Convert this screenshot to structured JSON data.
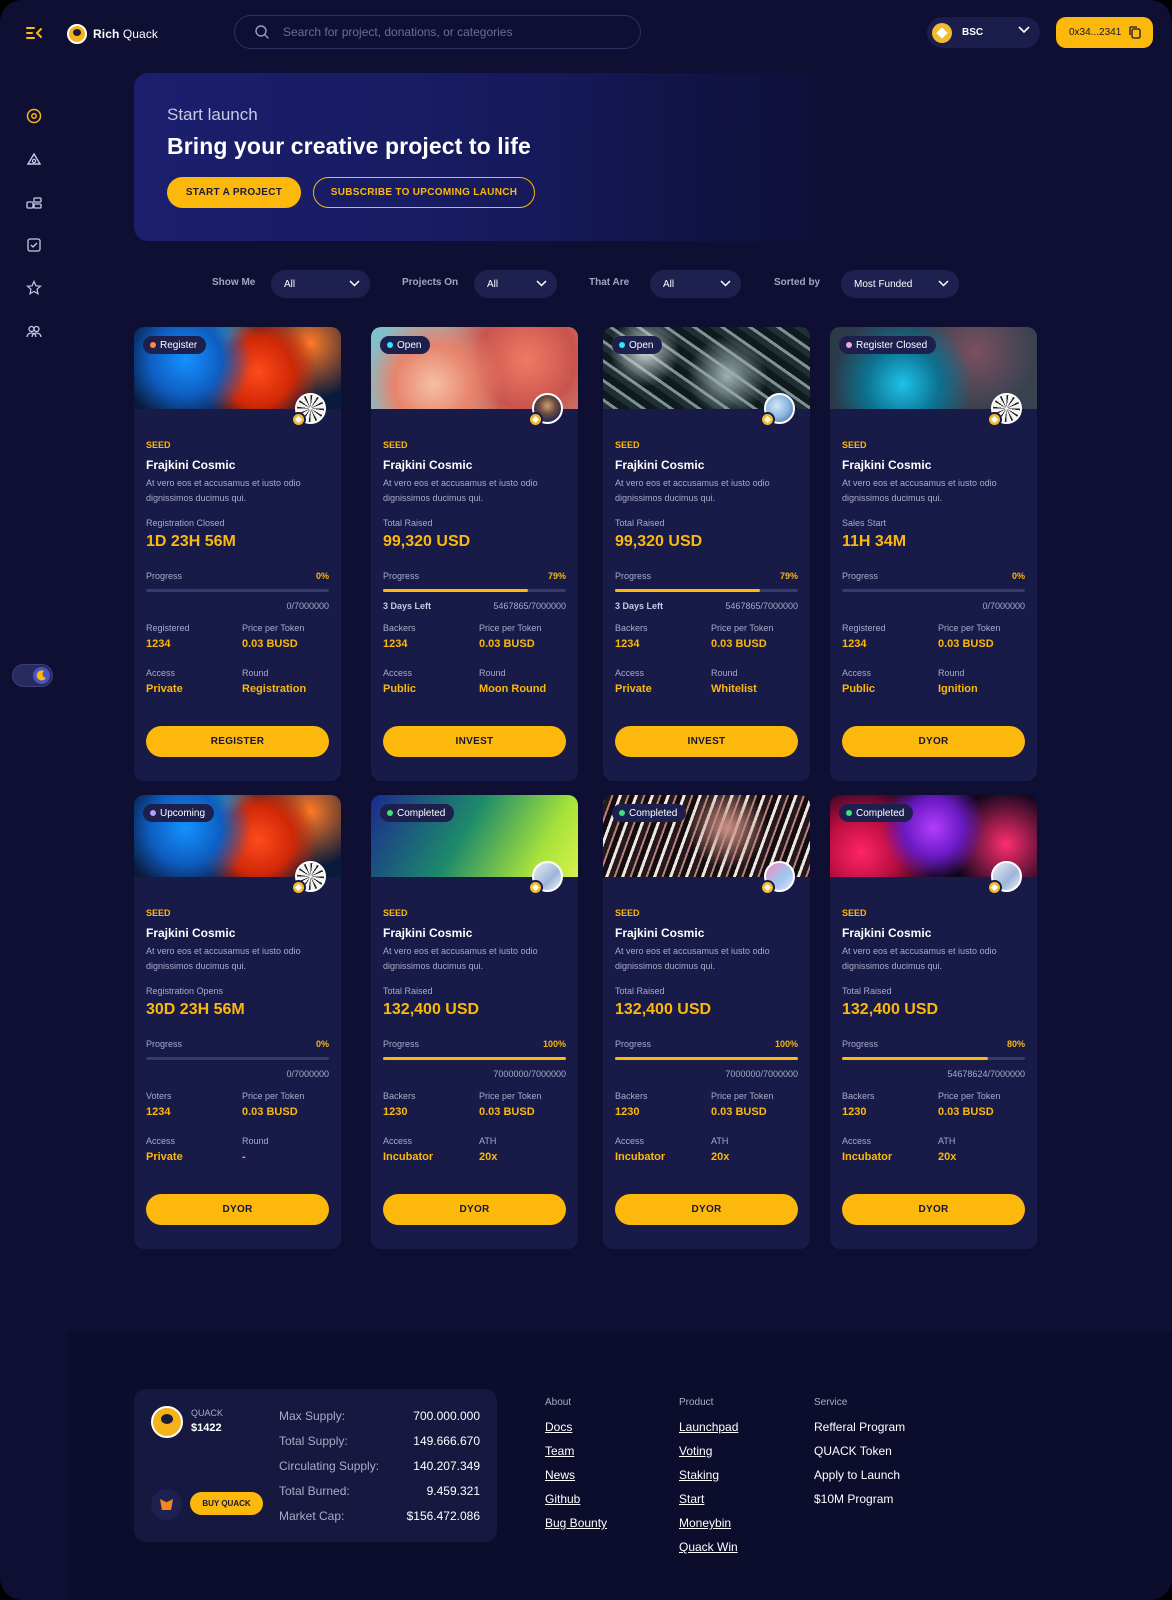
{
  "header": {
    "logo_bold": "Rich",
    "logo_light": "Quack",
    "search_placeholder": "Search for project, donations, or categories",
    "chain": "BSC",
    "wallet": "0x34...2341"
  },
  "hero": {
    "kicker": "Start launch",
    "title": "Bring your creative project to life",
    "start_btn": "START A PROJECT",
    "subscribe_btn": "SUBSCRIBE TO UPCOMING LAUNCH"
  },
  "filters": {
    "show_me": {
      "label": "Show Me",
      "value": "All"
    },
    "projects_on": {
      "label": "Projects On",
      "value": "All"
    },
    "that_are": {
      "label": "That Are",
      "value": "All"
    },
    "sorted_by": {
      "label": "Sorted by",
      "value": "Most Funded"
    }
  },
  "colors": {
    "accent": "#fcb80b",
    "background": "#0e0f33",
    "card": "#181a48"
  },
  "cards": [
    {
      "status": "Register",
      "dot": "#ff8a3d",
      "image": "fire",
      "avatar": "a",
      "stage": "SEED",
      "title": "Frajkini Cosmic",
      "desc": "At vero eos et accusamus et iusto odio dignissimos ducimus qui.",
      "stat_label": "Registration Closed",
      "stat_value": "1D 23H 56M",
      "progress_label": "Progress",
      "progress_pct": "0%",
      "progress": 0,
      "days_left": "",
      "count": "0/7000000",
      "k1": "Registered",
      "v1": "1234",
      "k2": "Price per Token",
      "v2": "0.03 BUSD",
      "k3": "Access",
      "v3": "Private",
      "k4": "Round",
      "v4": "Registration",
      "button": "REGISTER"
    },
    {
      "status": "Open",
      "dot": "#2ee6ff",
      "image": "cloud",
      "avatar": "b",
      "stage": "SEED",
      "title": "Frajkini Cosmic",
      "desc": "At vero eos et accusamus et iusto odio dignissimos ducimus qui.",
      "stat_label": "Total Raised",
      "stat_value": "99,320 USD",
      "progress_label": "Progress",
      "progress_pct": "79%",
      "progress": 0.79,
      "days_left": "3 Days Left",
      "count": "5467865/7000000",
      "k1": "Backers",
      "v1": "1234",
      "k2": "Price per Token",
      "v2": "0.03 BUSD",
      "k3": "Access",
      "v3": "Public",
      "k4": "Round",
      "v4": "Moon Round",
      "button": "INVEST"
    },
    {
      "status": "Open",
      "dot": "#2ee6ff",
      "image": "marble",
      "avatar": "c",
      "stage": "SEED",
      "title": "Frajkini Cosmic",
      "desc": "At vero eos et accusamus et iusto odio dignissimos ducimus qui.",
      "stat_label": "Total Raised",
      "stat_value": "99,320 USD",
      "progress_label": "Progress",
      "progress_pct": "79%",
      "progress": 0.79,
      "days_left": "3 Days Left",
      "count": "5467865/7000000",
      "k1": "Backers",
      "v1": "1234",
      "k2": "Price per Token",
      "v2": "0.03 BUSD",
      "k3": "Access",
      "v3": "Private",
      "k4": "Round",
      "v4": "Whitelist",
      "button": "INVEST"
    },
    {
      "status": "Register Closed",
      "dot": "#f0a8d0",
      "image": "blur",
      "avatar": "a",
      "stage": "SEED",
      "title": "Frajkini Cosmic",
      "desc": "At vero eos et accusamus et iusto odio dignissimos ducimus qui.",
      "stat_label": "Sales Start",
      "stat_value": "11H 34M",
      "progress_label": "Progress",
      "progress_pct": "0%",
      "progress": 0,
      "days_left": "",
      "count": "0/7000000",
      "k1": "Registered",
      "v1": "1234",
      "k2": "Price per Token",
      "v2": "0.03 BUSD",
      "k3": "Access",
      "v3": "Public",
      "k4": "Round",
      "v4": "Ignition",
      "button": "DYOR"
    },
    {
      "status": "Upcoming",
      "dot": "#b79cff",
      "image": "fire",
      "avatar": "a",
      "stage": "SEED",
      "title": "Frajkini Cosmic",
      "desc": "At vero eos et accusamus et iusto odio dignissimos ducimus qui.",
      "stat_label": "Registration Opens",
      "stat_value": "30D 23H 56M",
      "progress_label": "Progress",
      "progress_pct": "0%",
      "progress": 0,
      "days_left": "",
      "count": "0/7000000",
      "k1": "Voters",
      "v1": "1234",
      "k2": "Price per Token",
      "v2": "0.03 BUSD",
      "k3": "Access",
      "v3": "Private",
      "k4": "Round",
      "v4": "-",
      "button": "DYOR"
    },
    {
      "status": "Completed",
      "dot": "#3ee07a",
      "image": "gradient",
      "avatar": "d",
      "stage": "SEED",
      "title": "Frajkini Cosmic",
      "desc": "At vero eos et accusamus et iusto odio dignissimos ducimus qui.",
      "stat_label": "Total Raised",
      "stat_value": "132,400 USD",
      "progress_label": "Progress",
      "progress_pct": "100%",
      "progress": 1,
      "days_left": "",
      "count": "7000000/7000000",
      "k1": "Backers",
      "v1": "1230",
      "k2": "Price per Token",
      "v2": "0.03 BUSD",
      "k3": "Access",
      "v3": "Incubator",
      "k4": "ATH",
      "v4": "20x",
      "button": "DYOR"
    },
    {
      "status": "Completed",
      "dot": "#3ee07a",
      "image": "feather",
      "avatar": "e",
      "stage": "SEED",
      "title": "Frajkini Cosmic",
      "desc": "At vero eos et accusamus et iusto odio dignissimos ducimus qui.",
      "stat_label": "Total Raised",
      "stat_value": "132,400 USD",
      "progress_label": "Progress",
      "progress_pct": "100%",
      "progress": 1,
      "days_left": "",
      "count": "7000000/7000000",
      "k1": "Backers",
      "v1": "1230",
      "k2": "Price per Token",
      "v2": "0.03 BUSD",
      "k3": "Access",
      "v3": "Incubator",
      "k4": "ATH",
      "v4": "20x",
      "button": "DYOR"
    },
    {
      "status": "Completed",
      "dot": "#3ee07a",
      "image": "nebula",
      "avatar": "d",
      "stage": "SEED",
      "title": "Frajkini Cosmic",
      "desc": "At vero eos et accusamus et iusto odio dignissimos ducimus qui.",
      "stat_label": "Total Raised",
      "stat_value": "132,400 USD",
      "progress_label": "Progress",
      "progress_pct": "80%",
      "progress": 0.8,
      "days_left": "",
      "count": "54678624/7000000",
      "k1": "Backers",
      "v1": "1230",
      "k2": "Price per Token",
      "v2": "0.03 BUSD",
      "k3": "Access",
      "v3": "Incubator",
      "k4": "ATH",
      "v4": "20x",
      "button": "DYOR"
    }
  ],
  "footer": {
    "token": {
      "name": "QUACK",
      "price": "$1422",
      "buy": "BUY QUACK",
      "stats": [
        {
          "label": "Max Supply:",
          "value": "700.000.000"
        },
        {
          "label": "Total Supply:",
          "value": "149.666.670"
        },
        {
          "label": "Circulating Supply:",
          "value": "140.207.349"
        },
        {
          "label": "Total Burned:",
          "value": "9.459.321"
        },
        {
          "label": "Market Cap:",
          "value": "$156.472.086"
        }
      ]
    },
    "about": {
      "title": "About",
      "links": [
        "Docs",
        "Team",
        "News",
        "Github",
        "Bug Bounty"
      ]
    },
    "product": {
      "title": "Product",
      "links": [
        "Launchpad",
        "Voting",
        "Staking",
        "Start",
        "Moneybin",
        "Quack Win"
      ]
    },
    "service": {
      "title": "Service",
      "links": [
        "Refferal Program",
        "QUACK Token",
        "Apply to Launch",
        "$10M Program"
      ]
    }
  }
}
